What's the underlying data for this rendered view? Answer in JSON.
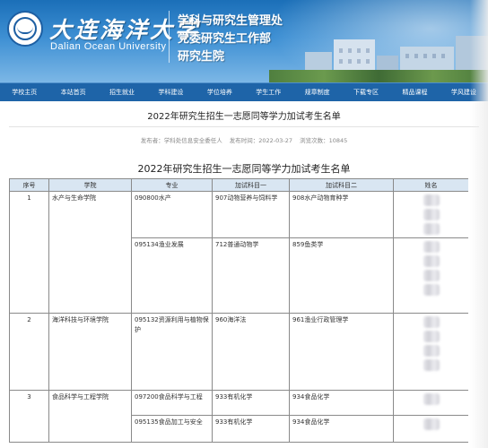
{
  "header": {
    "logo_cn": "大连海洋大学",
    "logo_en": "Dalian Ocean University",
    "dept_lines": [
      "学科与研究生管理处",
      "党委研究生工作部",
      "研究生院"
    ]
  },
  "nav": [
    "学校主页",
    "本站首页",
    "招生就业",
    "学科建设",
    "学位培养",
    "学生工作",
    "规章制度",
    "下载专区",
    "精品课程",
    "学风建设"
  ],
  "article": {
    "title": "2022年研究生招生一志愿同等学力加试考生名单",
    "meta": {
      "publisher": "发布者：学科处信息安全委任人",
      "date": "发布时间：2022-03-27",
      "views": "浏览次数：10845"
    },
    "table_title": "2022年研究生招生一志愿同等学力加试考生名单"
  },
  "table": {
    "headers": [
      "序号",
      "学院",
      "专业",
      "加试科目一",
      "加试科目二",
      "姓名"
    ],
    "rows": [
      {
        "no": "1",
        "college": "水产与生命学院",
        "major": "090800水产",
        "subj1": "907动物营养与饲料学",
        "subj2": "908水产动物育种学"
      },
      {
        "no": "",
        "college": "",
        "major": "095134渔业发展",
        "subj1": "712普通动物学",
        "subj2": "859鱼类学"
      },
      {
        "no": "2",
        "college": "海洋科技与环境学院",
        "major": "095132资源利用与植物保护",
        "subj1": "960海洋法",
        "subj2": "961渔业行政管理学"
      },
      {
        "no": "3",
        "college": "食品科学与工程学院",
        "major": "097200食品科学与工程",
        "subj1": "933有机化学",
        "subj2": "934食品化学"
      },
      {
        "no": "",
        "college": "",
        "major": "095135食品加工与安全",
        "subj1": "933有机化学",
        "subj2": "934食品化学"
      }
    ]
  },
  "colors": {
    "nav_bg": "#1e64a8",
    "header_bg": "#d9e6f2",
    "banner_top": "#1b6fb8"
  }
}
